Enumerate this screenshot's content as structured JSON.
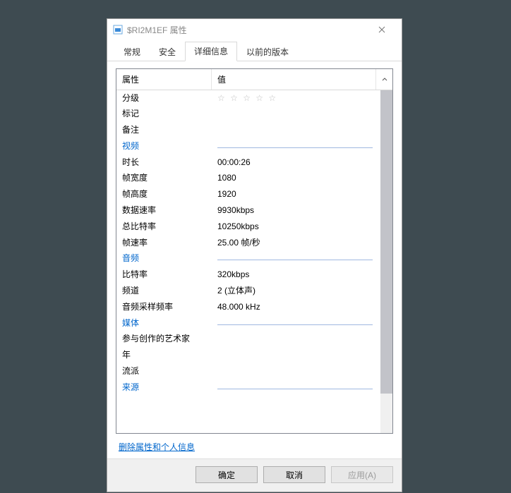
{
  "window": {
    "title": "$RI2M1EF 属性"
  },
  "tabs": {
    "general": "常规",
    "security": "安全",
    "details": "详细信息",
    "previous": "以前的版本",
    "active_index": 2
  },
  "headers": {
    "property": "属性",
    "value": "值"
  },
  "rows": {
    "rating_label": "分级",
    "rating_stars": "☆ ☆ ☆ ☆ ☆",
    "tags_label": "标记",
    "tags_value": "",
    "comments_label": "备注",
    "comments_value": "",
    "section_video": "视频",
    "duration_label": "时长",
    "duration_value": "00:00:26",
    "frame_width_label": "帧宽度",
    "frame_width_value": "1080",
    "frame_height_label": "帧高度",
    "frame_height_value": "1920",
    "data_rate_label": "数据速率",
    "data_rate_value": "9930kbps",
    "total_bitrate_label": "总比特率",
    "total_bitrate_value": "10250kbps",
    "frame_rate_label": "帧速率",
    "frame_rate_value": "25.00 帧/秒",
    "section_audio": "音频",
    "bitrate_label": "比特率",
    "bitrate_value": "320kbps",
    "channels_label": "频道",
    "channels_value": "2 (立体声)",
    "sample_rate_label": "音频采样频率",
    "sample_rate_value": "48.000 kHz",
    "section_media": "媒体",
    "contrib_artists_label": "参与创作的艺术家",
    "contrib_artists_value": "",
    "year_label": "年",
    "year_value": "",
    "genre_label": "流派",
    "genre_value": "",
    "section_origin": "来源"
  },
  "link": {
    "remove_props": "删除属性和个人信息"
  },
  "buttons": {
    "ok": "确定",
    "cancel": "取消",
    "apply": "应用(A)"
  }
}
